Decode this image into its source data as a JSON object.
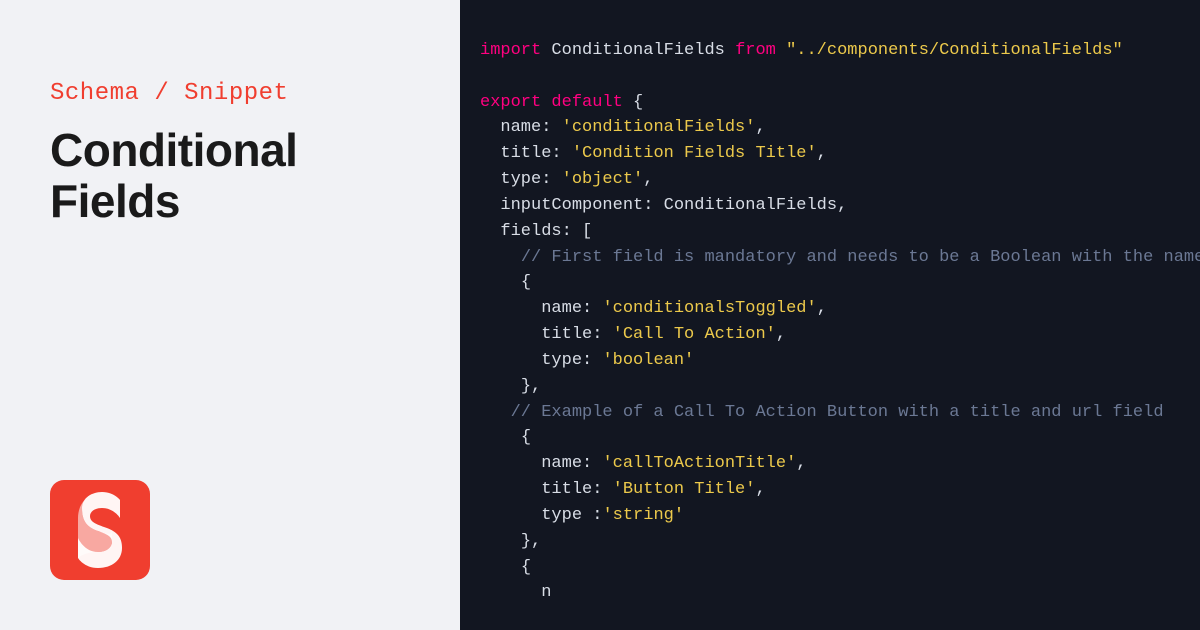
{
  "sidebar": {
    "breadcrumb": "Schema / Snippet",
    "title": "Conditional Fields",
    "logo_name": "sanity-logo"
  },
  "code": {
    "import_keyword": "import",
    "import_ident": "ConditionalFields",
    "from_keyword": "from",
    "import_path": "\"../components/ConditionalFields\"",
    "export_keyword": "export",
    "default_keyword": "default",
    "schema": {
      "name_key": "name:",
      "name_val": "'conditionalFields'",
      "title_key": "title:",
      "title_val": "'Condition Fields Title'",
      "type_key": "type:",
      "type_val": "'object'",
      "inputComponent_key": "inputComponent:",
      "inputComponent_val": "ConditionalFields",
      "fields_key": "fields:",
      "comment1": "// First field is mandatory and needs to be a Boolean with the name: `conditio",
      "field1": {
        "name_key": "name:",
        "name_val": "'conditionalsToggled'",
        "title_key": "title:",
        "title_val": "'Call To Action'",
        "type_key": "type:",
        "type_val": "'boolean'"
      },
      "comment2": "// Example of a Call To Action Button with a title and url field",
      "field2": {
        "name_key": "name:",
        "name_val": "'callToActionTitle'",
        "title_key": "title:",
        "title_val": "'Button Title'",
        "type_key": "type :",
        "type_val": "'string'"
      },
      "field3_partial": "n"
    }
  }
}
